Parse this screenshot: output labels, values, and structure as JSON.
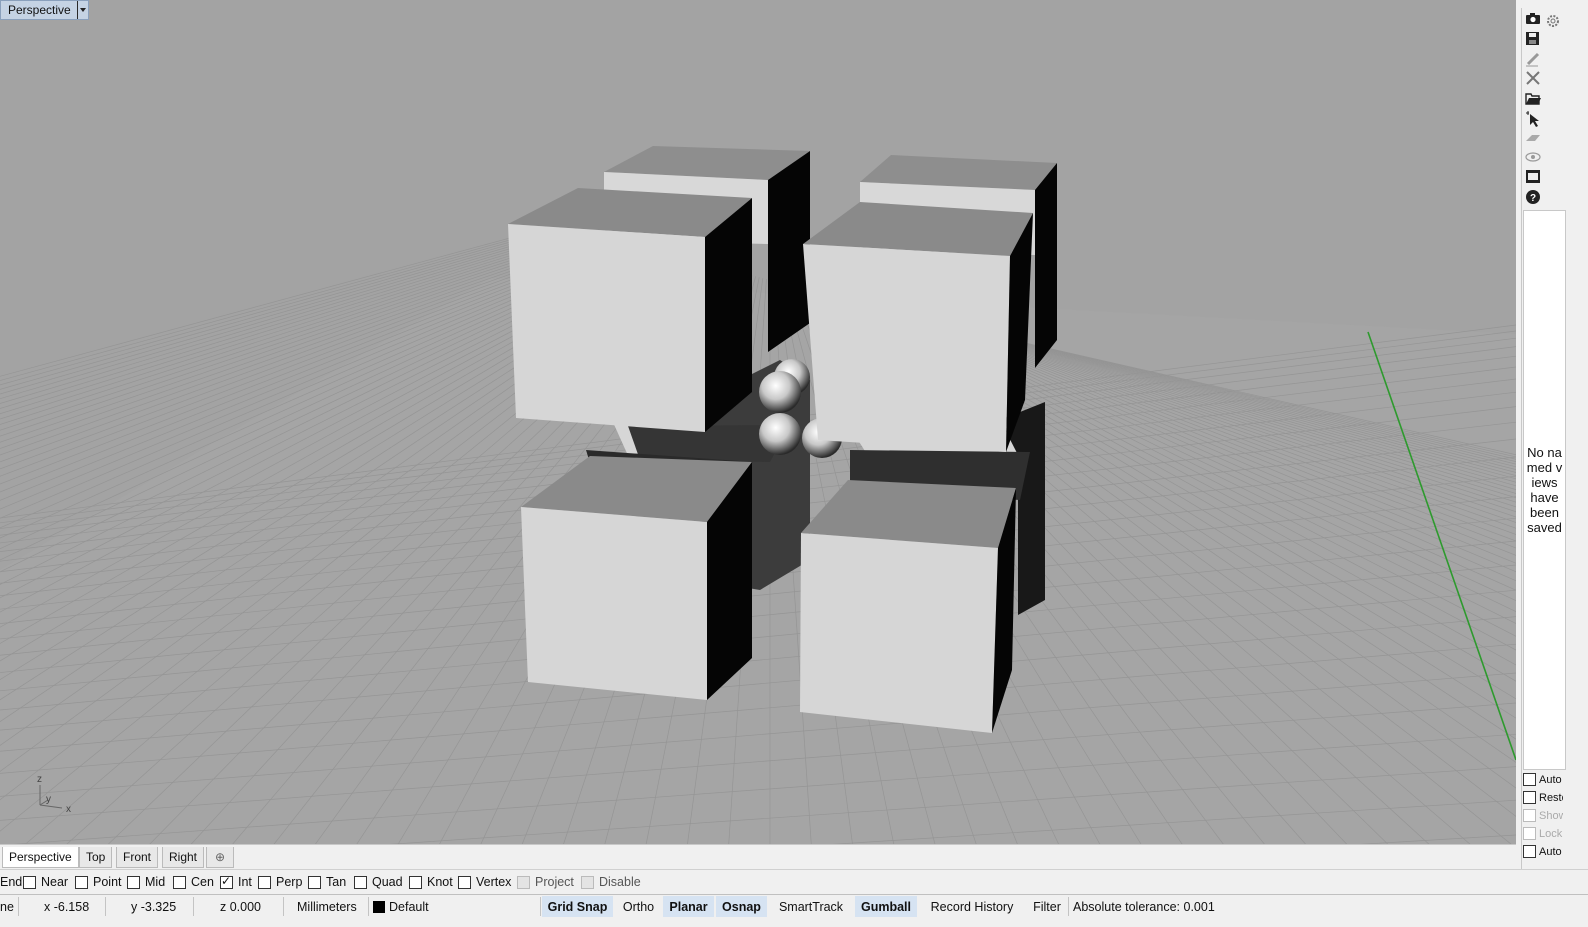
{
  "viewport": {
    "title": "Perspective",
    "axes": {
      "z": "z",
      "y": "y",
      "x": "x"
    }
  },
  "right_panel": {
    "tool_icons": [
      "camera-icon",
      "gear-icon",
      "save-icon",
      "edit-icon",
      "delete-icon",
      "open-folder-icon",
      "select-icon",
      "plane-icon",
      "eye-icon",
      "film-icon",
      "help-icon"
    ],
    "named_views_message": "No named views have been saved",
    "checkboxes": [
      {
        "label": "Auto",
        "disabled": false
      },
      {
        "label": "Resto",
        "disabled": false
      },
      {
        "label": "Show",
        "disabled": true
      },
      {
        "label": "Lock",
        "disabled": true
      },
      {
        "label": "Auto",
        "disabled": false
      }
    ]
  },
  "tabs": [
    "Perspective",
    "Top",
    "Front",
    "Right"
  ],
  "tab_add_icon": "plus-icon",
  "osnap": {
    "first_label": "End",
    "items": [
      {
        "label": "Near",
        "checked": false
      },
      {
        "label": "Point",
        "checked": false
      },
      {
        "label": "Mid",
        "checked": false
      },
      {
        "label": "Cen",
        "checked": false
      },
      {
        "label": "Int",
        "checked": true
      },
      {
        "label": "Perp",
        "checked": false
      },
      {
        "label": "Tan",
        "checked": false
      },
      {
        "label": "Quad",
        "checked": false
      },
      {
        "label": "Knot",
        "checked": false
      },
      {
        "label": "Vertex",
        "checked": false
      }
    ],
    "project_label": "Project",
    "disable_label": "Disable"
  },
  "status": {
    "plane": "ne",
    "x": "x -6.158",
    "y": "y -3.325",
    "z": "z 0.000",
    "units": "Millimeters",
    "layer": "Default",
    "layer_color": "#000000",
    "buttons": [
      {
        "label": "Grid Snap",
        "on": true
      },
      {
        "label": "Ortho",
        "on": false
      },
      {
        "label": "Planar",
        "on": true
      },
      {
        "label": "Osnap",
        "on": true
      },
      {
        "label": "SmartTrack",
        "on": false
      },
      {
        "label": "Gumball",
        "on": true
      },
      {
        "label": "Record History",
        "on": false
      },
      {
        "label": "Filter",
        "on": false
      }
    ],
    "tolerance": "Absolute tolerance: 0.001"
  }
}
